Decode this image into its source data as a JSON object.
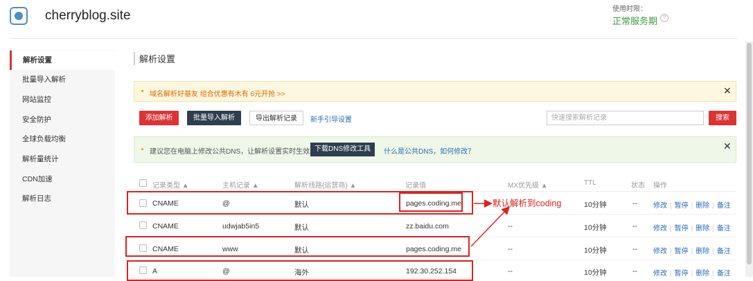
{
  "header": {
    "site_name": "cherryblog.site",
    "expire_label": "使用时限：",
    "expire_status": "正常服务期"
  },
  "sidebar": {
    "items": [
      {
        "label": "解析设置",
        "active": true
      },
      {
        "label": "批量导入解析"
      },
      {
        "label": "网站监控"
      },
      {
        "label": "安全防护"
      },
      {
        "label": "全球负载均衡"
      },
      {
        "label": "解析量统计"
      },
      {
        "label": "CDN加速"
      },
      {
        "label": "解析日志"
      }
    ]
  },
  "main": {
    "title": "解析设置",
    "promo_notice": "域名解析好基友 组合优惠有木有 6元开抢 >>",
    "toolbar": {
      "add_label": "添加解析",
      "import_label": "批量导入解析",
      "export_label": "导出解析记录",
      "guide_label": "新手引导设置",
      "search_placeholder": "快速搜索解析记录",
      "search_label": "搜索"
    },
    "dns_notice": {
      "text": "建议您在电脑上修改公共DNS，让解析设置实时生效。",
      "button": "下载DNS修改工具",
      "link": "什么是公共DNS，如何修改？"
    }
  },
  "table": {
    "headers": [
      "记录类型 ▲",
      "主机记录 ▲",
      "解析线路(运营商) ▲",
      "记录值",
      "MX优先级 ▲",
      "TTL",
      "状态",
      "操作"
    ],
    "rows": [
      {
        "type": "CNAME",
        "host": "@",
        "line": "默认",
        "value": "pages.coding.me",
        "mx": "",
        "ttl": "10分钟",
        "status": "--"
      },
      {
        "type": "CNAME",
        "host": "udwjab5in5",
        "line": "默认",
        "value": "zz.baidu.com",
        "mx": "--",
        "ttl": "10分钟",
        "status": "--"
      },
      {
        "type": "CNAME",
        "host": "www",
        "line": "默认",
        "value": "pages.coding.me",
        "mx": "--",
        "ttl": "10分钟",
        "status": "--"
      },
      {
        "type": "A",
        "host": "@",
        "line": "海外",
        "value": "192.30.252.154",
        "mx": "--",
        "ttl": "10分钟",
        "status": "--"
      }
    ],
    "ops": {
      "edit": "修改",
      "pause": "暂停",
      "delete": "删除",
      "note": "备注"
    }
  },
  "annotation": {
    "text": "默认解析到coding",
    "color": "#e02020"
  },
  "colors": {
    "accent_red": "#dd3333",
    "dark_button": "#2f3e4d",
    "link": "#2a6db5",
    "status_green": "#3c9a3c"
  }
}
